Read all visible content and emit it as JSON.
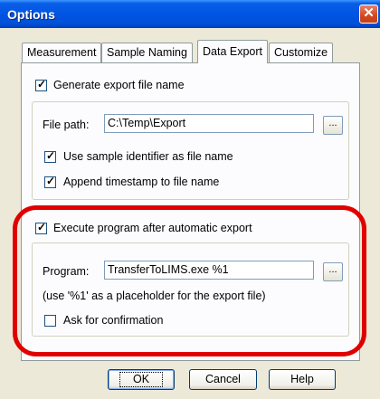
{
  "window": {
    "title": "Options",
    "close_glyph": "✕"
  },
  "tabs": [
    {
      "label": "Measurement",
      "active": false
    },
    {
      "label": "Sample Naming",
      "active": false
    },
    {
      "label": "Data Export",
      "active": true
    },
    {
      "label": "Customize",
      "active": false
    }
  ],
  "export": {
    "generate_label": "Generate export file name",
    "generate_checked": true,
    "file_path_label": "File path:",
    "file_path_value": "C:\\Temp\\Export",
    "use_identifier_label": "Use sample identifier as file name",
    "use_identifier_checked": true,
    "append_timestamp_label": "Append timestamp to file name",
    "append_timestamp_checked": true
  },
  "execute": {
    "execute_label": "Execute program after automatic export",
    "execute_checked": true,
    "program_label": "Program:",
    "program_value": "TransferToLIMS.exe %1",
    "hint": "(use '%1' as a placeholder for the export file)",
    "ask_label": "Ask for confirmation",
    "ask_checked": false
  },
  "browse_label": "...",
  "check_glyph": "✓",
  "buttons": {
    "ok": "OK",
    "cancel": "Cancel",
    "help": "Help"
  },
  "colors": {
    "titlebar": "#0054e3",
    "highlight": "#e00000",
    "dialog_bg": "#ece9d8"
  },
  "icons": {
    "close": "close-icon",
    "check": "checkmark-icon"
  }
}
